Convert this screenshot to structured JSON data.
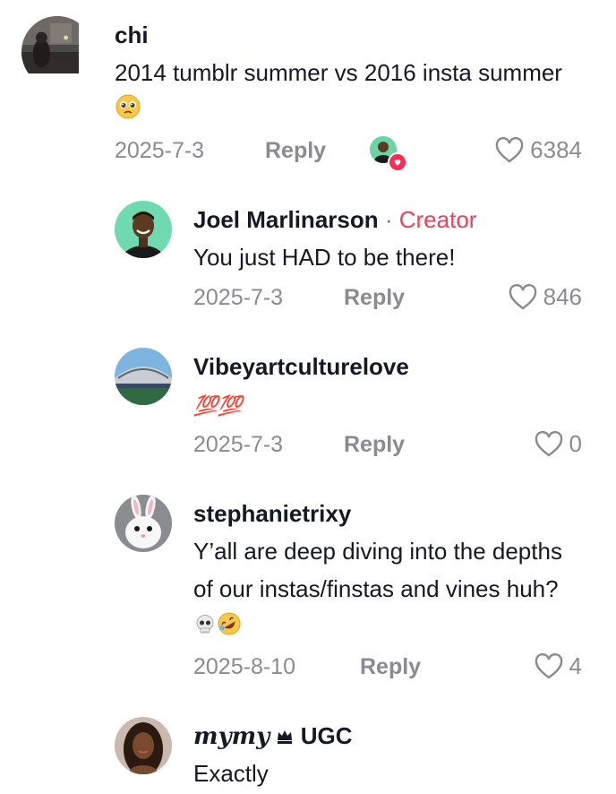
{
  "comments": [
    {
      "username": "chi",
      "text": "2014 tumblr summer vs 2016 insta summer",
      "emoji": "pleading-face",
      "date": "2025-7-3",
      "reply_label": "Reply",
      "likes": "6384",
      "creator_liked": true
    },
    {
      "username": "Joel Marlinarson",
      "badge": "· Creator",
      "text": "You just HAD to be there!",
      "date": "2025-7-3",
      "reply_label": "Reply",
      "likes": "846"
    },
    {
      "username": "Vibeyartculturelove",
      "text": "💯💯",
      "date": "2025-7-3",
      "reply_label": "Reply",
      "likes": "0"
    },
    {
      "username": "stephanietrixy",
      "text": "Y’all are deep diving into the depths of our instas/finstas and vines huh?",
      "emoji": "skull, rolling-on-floor-laughing",
      "date": "2025-8-10",
      "reply_label": "Reply",
      "likes": "4"
    },
    {
      "username_styled": "𝒎𝒚𝒎𝒚",
      "username_suffix": "UGC",
      "crown_icon": "crown-icon",
      "text": "Exactly"
    }
  ],
  "colors": {
    "text": "#161823",
    "muted": "#8a8b91",
    "creator_badge": "#e8435a",
    "like_badge": "#fe2c55"
  }
}
